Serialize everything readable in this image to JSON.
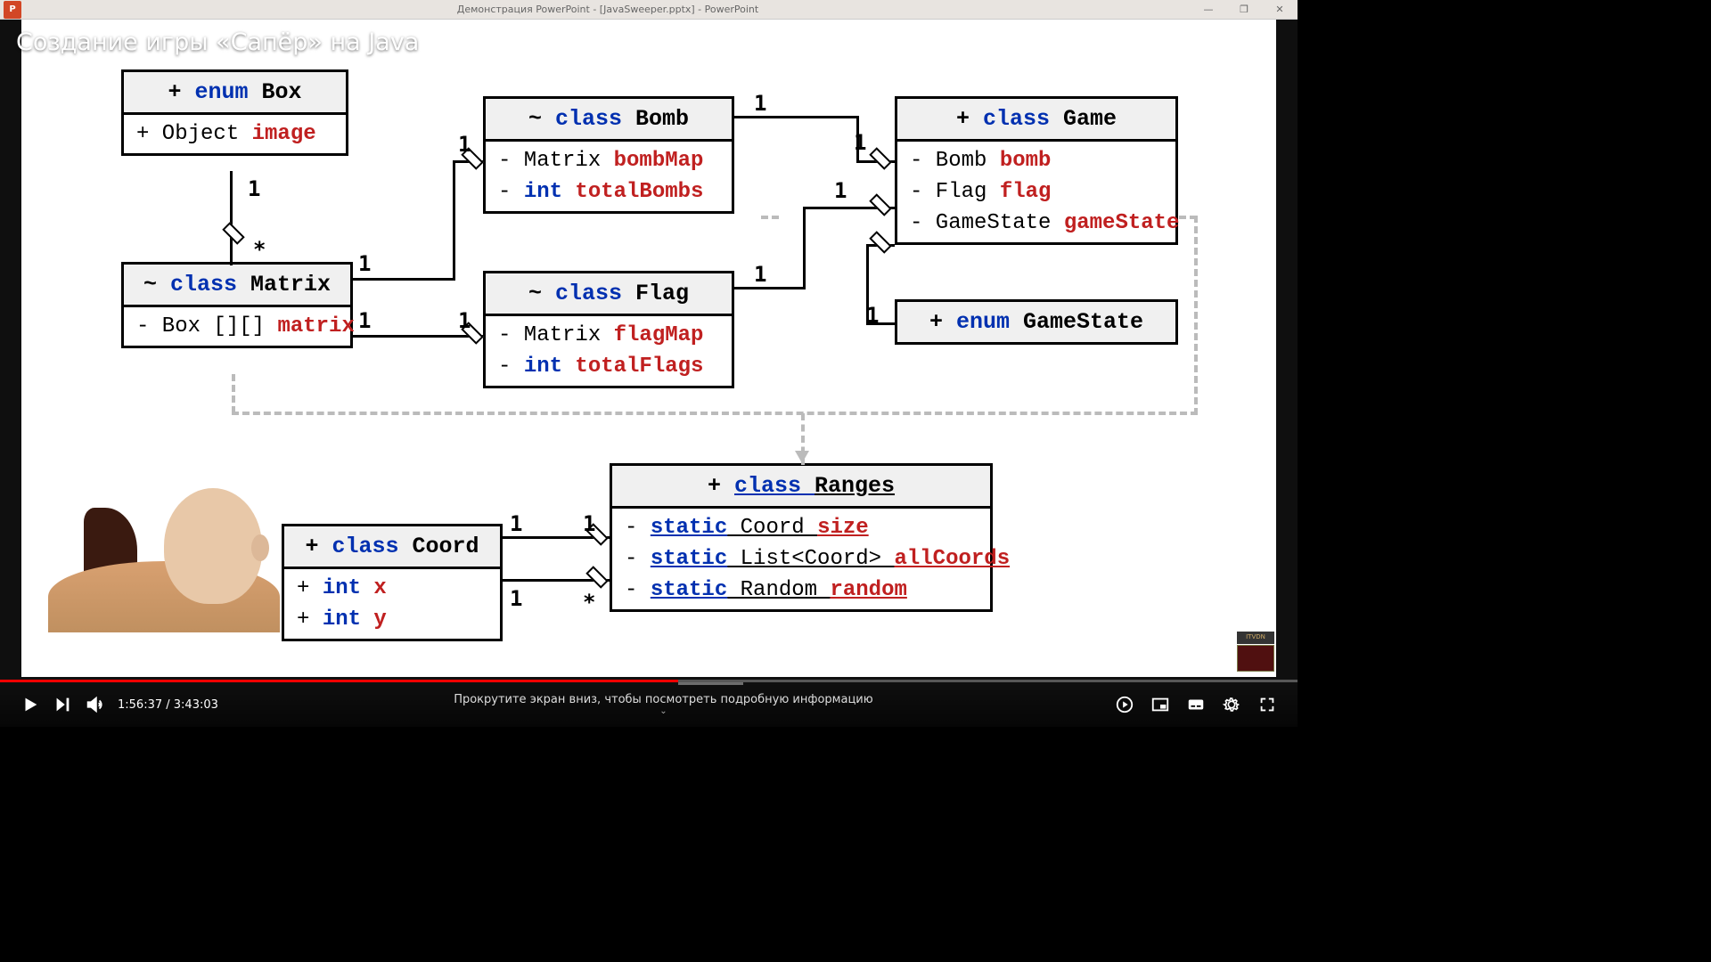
{
  "titlebar": {
    "app_icon": "P",
    "title": "Демонстрация PowerPoint - [JavaSweeper.pptx] - PowerPoint",
    "min": "—",
    "max": "❐",
    "close": "✕"
  },
  "video": {
    "title": "Создание игры «Сапёр» на Java",
    "time_current": "1:56:37",
    "time_total": "3:43:03",
    "time_sep": " / ",
    "scroll_hint": "Прокрутите экран вниз, чтобы посмотреть подробную информацию",
    "chevron": "⌄",
    "watermark": "ITVDN"
  },
  "uml": {
    "box": {
      "vis": "+ ",
      "kw": "enum ",
      "name": "Box",
      "r1_pre": "+ Object ",
      "r1_name": "image"
    },
    "bomb": {
      "vis": "~ ",
      "kw": "class ",
      "name": "Bomb",
      "r1_pre": "- Matrix ",
      "r1_name": "bombMap",
      "r2_pre": "- ",
      "r2_kw": "int ",
      "r2_name": "totalBombs"
    },
    "game": {
      "vis": "+ ",
      "kw": "class ",
      "name": "Game",
      "r1_pre": "- Bomb ",
      "r1_name": "bomb",
      "r2_pre": "- Flag ",
      "r2_name": "flag",
      "r3_pre": "- GameState ",
      "r3_name": "gameState"
    },
    "matrix": {
      "vis": "~ ",
      "kw": "class ",
      "name": "Matrix",
      "r1_pre": "- Box [][] ",
      "r1_name": "matrix"
    },
    "flag": {
      "vis": "~ ",
      "kw": "class ",
      "name": "Flag",
      "r1_pre": "- Matrix ",
      "r1_name": "flagMap",
      "r2_pre": "- ",
      "r2_kw": "int ",
      "r2_name": "totalFlags"
    },
    "gamestate": {
      "vis": "+ ",
      "kw": "enum ",
      "name": "GameState"
    },
    "ranges": {
      "vis": "+ ",
      "kw": "class ",
      "name": "Ranges",
      "r1_kw1": "- ",
      "r1_kw2": "static",
      "r1_mid": " Coord ",
      "r1_name": "size",
      "r2_kw1": "- ",
      "r2_kw2": "static",
      "r2_mid": " List<Coord> ",
      "r2_name": "allCoords",
      "r3_kw1": "- ",
      "r3_kw2": "static",
      "r3_mid": " Random ",
      "r3_name": "random"
    },
    "coord": {
      "vis": "+ ",
      "kw": "class ",
      "name": "Coord",
      "r1_pre": "+ ",
      "r1_kw": "int ",
      "r1_name": "x",
      "r2_pre": "+ ",
      "r2_kw": "int ",
      "r2_name": "y"
    }
  },
  "mult": {
    "one": "1",
    "star": "*"
  },
  "chart_data": {
    "type": "table",
    "description": "UML class diagram with association multiplicities",
    "classes": [
      {
        "name": "Box",
        "stereotype": "enum",
        "visibility": "+",
        "members": [
          {
            "vis": "+",
            "type": "Object",
            "name": "image"
          }
        ]
      },
      {
        "name": "Matrix",
        "stereotype": "class",
        "visibility": "~",
        "members": [
          {
            "vis": "-",
            "type": "Box[][]",
            "name": "matrix"
          }
        ]
      },
      {
        "name": "Bomb",
        "stereotype": "class",
        "visibility": "~",
        "members": [
          {
            "vis": "-",
            "type": "Matrix",
            "name": "bombMap"
          },
          {
            "vis": "-",
            "type": "int",
            "name": "totalBombs"
          }
        ]
      },
      {
        "name": "Flag",
        "stereotype": "class",
        "visibility": "~",
        "members": [
          {
            "vis": "-",
            "type": "Matrix",
            "name": "flagMap"
          },
          {
            "vis": "-",
            "type": "int",
            "name": "totalFlags"
          }
        ]
      },
      {
        "name": "Game",
        "stereotype": "class",
        "visibility": "+",
        "members": [
          {
            "vis": "-",
            "type": "Bomb",
            "name": "bomb"
          },
          {
            "vis": "-",
            "type": "Flag",
            "name": "flag"
          },
          {
            "vis": "-",
            "type": "GameState",
            "name": "gameState"
          }
        ]
      },
      {
        "name": "GameState",
        "stereotype": "enum",
        "visibility": "+",
        "members": []
      },
      {
        "name": "Coord",
        "stereotype": "class",
        "visibility": "+",
        "members": [
          {
            "vis": "+",
            "type": "int",
            "name": "x"
          },
          {
            "vis": "+",
            "type": "int",
            "name": "y"
          }
        ]
      },
      {
        "name": "Ranges",
        "stereotype": "class",
        "visibility": "+",
        "members": [
          {
            "vis": "-",
            "modifier": "static",
            "type": "Coord",
            "name": "size"
          },
          {
            "vis": "-",
            "modifier": "static",
            "type": "List<Coord>",
            "name": "allCoords"
          },
          {
            "vis": "-",
            "modifier": "static",
            "type": "Random",
            "name": "random"
          }
        ]
      }
    ],
    "associations": [
      {
        "from": "Matrix",
        "to": "Box",
        "type": "aggregation",
        "from_mult": "*",
        "to_mult": "1"
      },
      {
        "from": "Bomb",
        "to": "Matrix",
        "type": "aggregation",
        "from_mult": "1",
        "to_mult": "1"
      },
      {
        "from": "Flag",
        "to": "Matrix",
        "type": "aggregation",
        "from_mult": "1",
        "to_mult": "1"
      },
      {
        "from": "Game",
        "to": "Bomb",
        "type": "aggregation",
        "from_mult": "1",
        "to_mult": "1"
      },
      {
        "from": "Game",
        "to": "Flag",
        "type": "aggregation",
        "from_mult": "1",
        "to_mult": "1"
      },
      {
        "from": "Game",
        "to": "GameState",
        "type": "aggregation",
        "from_mult": "1",
        "to_mult": "1"
      },
      {
        "from": "Ranges",
        "to": "Coord",
        "type": "aggregation",
        "from_mult": "1",
        "to_mult": "1"
      },
      {
        "from": "Ranges",
        "to": "Coord",
        "type": "aggregation",
        "from_mult": "*",
        "to_mult": "1"
      },
      {
        "from": "*",
        "to": "Ranges",
        "type": "dependency"
      }
    ]
  }
}
